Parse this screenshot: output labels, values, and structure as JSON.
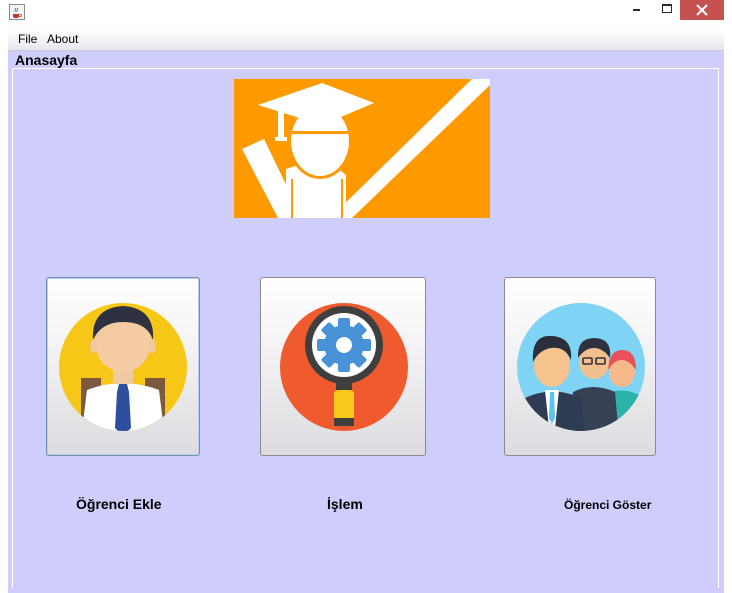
{
  "window": {
    "icon": "java-coffee-icon",
    "controls": {
      "minimize": "minimize-icon",
      "maximize": "maximize-icon",
      "close": "close-icon"
    }
  },
  "menu": {
    "items": [
      {
        "label": "File"
      },
      {
        "label": "About"
      }
    ]
  },
  "panel": {
    "title": "Anasayfa"
  },
  "banner": {
    "icon": "graduate-checkmark-icon",
    "colors": {
      "background": "#ff9900",
      "foreground": "#ffffff"
    }
  },
  "tiles": [
    {
      "label": "Öğrenci Ekle",
      "icon": "student-avatar-icon"
    },
    {
      "label": "İşlem",
      "icon": "magnifier-gear-icon"
    },
    {
      "label": "Öğrenci Göster",
      "icon": "student-group-icon"
    }
  ],
  "colors": {
    "panel_background": "#cecdfc",
    "close_button": "#c75050"
  }
}
